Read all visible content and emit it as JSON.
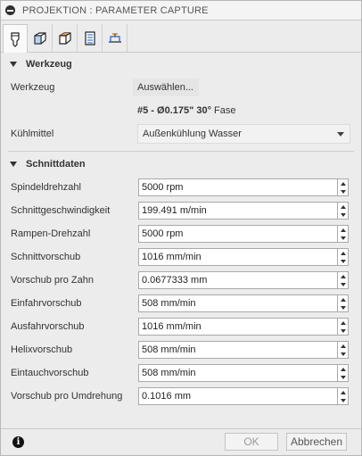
{
  "window": {
    "title": "PROJEKTION : PARAMETER CAPTURE"
  },
  "tabs": [
    {
      "icon": "tool-icon",
      "active": true
    },
    {
      "icon": "geometry-cube-icon"
    },
    {
      "icon": "heights-cube-icon"
    },
    {
      "icon": "passes-sheet-icon"
    },
    {
      "icon": "linking-icon"
    }
  ],
  "werkzeug_section": {
    "header": "Werkzeug",
    "tool_label": "Werkzeug",
    "select_button": "Auswählen...",
    "tool_desc_bold": "#5 - Ø0.175\" 30°",
    "tool_desc_rest": " Fase",
    "coolant_label": "Kühlmittel",
    "coolant_value": "Außenkühlung Wasser"
  },
  "schnittdaten": {
    "header": "Schnittdaten",
    "fields": [
      {
        "label": "Spindeldrehzahl",
        "value": "5000 rpm"
      },
      {
        "label": "Schnittgeschwindigkeit",
        "value": "199.491 m/min"
      },
      {
        "label": "Rampen-Drehzahl",
        "value": "5000 rpm"
      },
      {
        "label": "Schnittvorschub",
        "value": "1016 mm/min"
      },
      {
        "label": "Vorschub pro Zahn",
        "value": "0.0677333 mm"
      },
      {
        "label": "Einfahrvorschub",
        "value": "508 mm/min"
      },
      {
        "label": "Ausfahrvorschub",
        "value": "1016 mm/min"
      },
      {
        "label": "Helixvorschub",
        "value": "508 mm/min"
      },
      {
        "label": "Eintauchvorschub",
        "value": "508 mm/min"
      },
      {
        "label": "Vorschub pro Umdrehung",
        "value": "0.1016 mm"
      }
    ]
  },
  "footer": {
    "info_icon": "info-icon",
    "ok": "OK",
    "cancel": "Abbrechen"
  }
}
